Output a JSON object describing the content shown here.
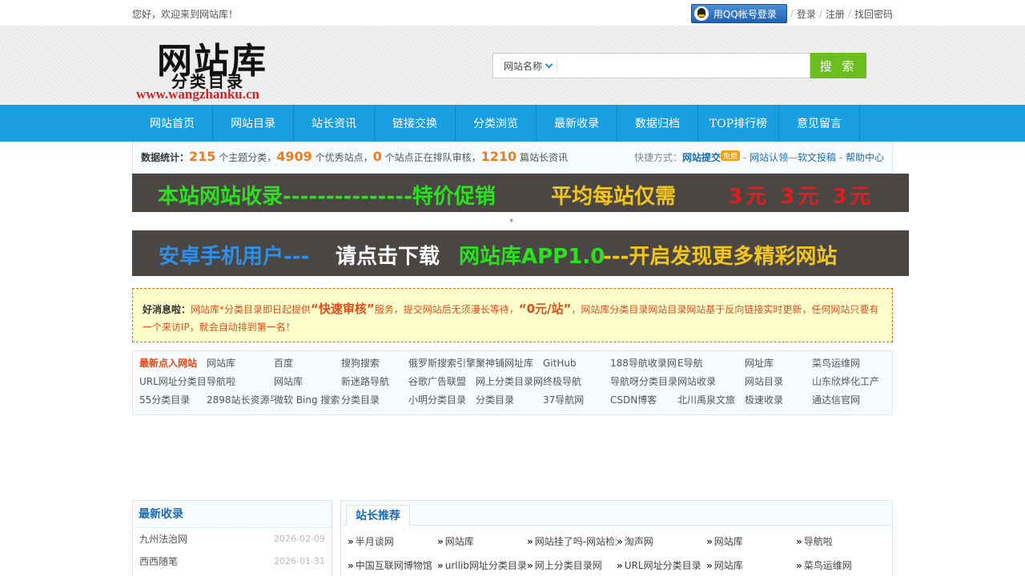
{
  "topbar": {
    "welcome": "您好，欢迎来到网站库！",
    "qq_login": "用QQ帐号登录",
    "login": "登录",
    "register": "注册",
    "recover": "找回密码"
  },
  "logo": {
    "title": "网站库",
    "subtitle": "分类目录",
    "url": "www.wangzhanku.cn"
  },
  "search": {
    "category": "网站名称",
    "button": "搜 索",
    "value": ""
  },
  "nav": [
    "网站首页",
    "网站目录",
    "站长资讯",
    "链接交换",
    "分类浏览",
    "最新收录",
    "数据归档",
    "TOP排行榜",
    "意见留言"
  ],
  "stats": {
    "label": "数据统计：",
    "categories": "215",
    "t1": "个主题分类，",
    "sites": "4909",
    "t2": "个优秀站点，",
    "queue": "0",
    "t3": "个站点正在排队审核，",
    "news": "1210",
    "t4": "篇站长资讯",
    "quick_label": "快捷方式：",
    "submit": "网站提交",
    "free": "免费",
    "claim": "网站认领",
    "article": "软文投稿",
    "help": "帮助中心"
  },
  "banner1": {
    "left": "本站网站收录---------------特价促销",
    "mid": "平均每站仅需",
    "price": "3元 3元 3元"
  },
  "separator": "*",
  "banner2": {
    "a": "安卓手机用户---",
    "b": "请点击下载",
    "c": "网站库APP1.0",
    "d": "---开启发现更多精彩网站"
  },
  "notice": {
    "label": "好消息啦：",
    "t1": "网站库*分类目录即日起提供",
    "h1": "“快速审核”",
    "t2": "服务，提交网站后无须漫长等待，",
    "h2": "“0元/站”",
    "t3": "，网站库分类目录网站目录网站基于反向链接实时更新，任何网站只要有一个来访IP，就会自动排到第一名！"
  },
  "latest": {
    "title": "最新点入网站",
    "items": [
      "网站库",
      "百度",
      "搜狗搜索",
      "俄罗斯搜索引擎",
      "聚神铺网址库",
      "GitHub",
      "188导航收录网",
      "E导航",
      "网址库",
      "菜鸟运维网",
      "URL网址分类目录",
      "导航啦",
      "网站库",
      "新迷路导航",
      "谷歌广告联盟",
      "网上分类目录网",
      "终极导航",
      "导航呀分类目录",
      "网站收录",
      "网站目录",
      "山东欣烨化工产品",
      "55分类目录",
      "2898站长资源平台",
      "微软 Bing 搜索",
      "分类目录",
      "小明分类目录",
      "分类目录",
      "37导航网",
      "CSDN博客",
      "北川禹泉文旅",
      "极速收录",
      "通达信官网"
    ]
  },
  "panel_left": {
    "title": "最新收录",
    "rows": [
      {
        "name": "九州法治网",
        "date": "2026-02-09"
      },
      {
        "name": "西西随笔",
        "date": "2026-01-31"
      }
    ]
  },
  "panel_right": {
    "tab": "站长推荐",
    "items": [
      "半月谈网",
      "网站库",
      "网站挂了吗-网站检测",
      "淘声网",
      "网站库",
      "导航啦",
      "中国互联网博物馆",
      "urllib网址分类目录",
      "网上分类目录网",
      "URL网址分类目录",
      "网站库",
      "菜鸟运维网"
    ]
  },
  "colors": {
    "nav_bg": "#1a9ee2",
    "search_btn": "#6cbd1e",
    "accent_orange": "#f27a1c",
    "notice_text": "#e64a19",
    "link_blue": "#1a6db3"
  }
}
